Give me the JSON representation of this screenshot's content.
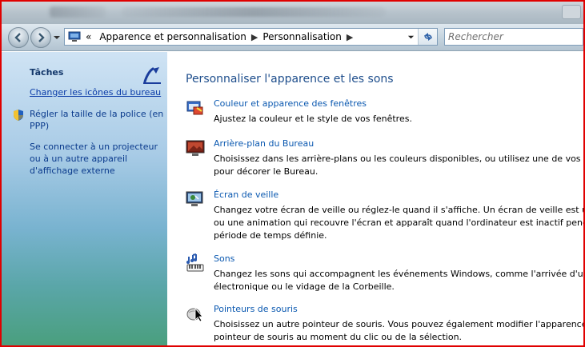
{
  "address": {
    "crumbs": [
      "Apparence et personnalisation",
      "Personnalisation"
    ],
    "overflow_chevron": "«"
  },
  "search": {
    "placeholder": "Rechercher"
  },
  "sidebar": {
    "title": "Tâches",
    "links": [
      {
        "lines": [
          "Changer les icônes du bureau"
        ]
      },
      {
        "lines": [
          "Régler la taille de la police (en",
          "PPP)"
        ]
      },
      {
        "lines": [
          "Se connecter à un projecteur",
          "ou à un autre appareil",
          "d'affichage externe"
        ]
      }
    ]
  },
  "main": {
    "title": "Personnaliser l'apparence et les sons",
    "items": [
      {
        "icon": "window-color-icon",
        "label": "Couleur et apparence des fenêtres",
        "desc": [
          "Ajustez la couleur et le style de vos fenêtres."
        ]
      },
      {
        "icon": "desktop-background-icon",
        "label": "Arrière-plan du Bureau",
        "desc": [
          "Choisissez dans les arrière-plans ou les couleurs disponibles, ou utilisez une de vos images",
          "pour décorer le Bureau."
        ]
      },
      {
        "icon": "screensaver-icon",
        "label": "Écran de veille",
        "desc": [
          "Changez votre écran de veille ou réglez-le quand il s'affiche. Un écran de veille est une image",
          "ou une animation qui recouvre l'écran et apparaît quand l'ordinateur est inactif pendant une",
          "période de temps définie."
        ]
      },
      {
        "icon": "sounds-icon",
        "label": "Sons",
        "desc": [
          "Changez les sons qui accompagnent les événements Windows, comme l'arrivée d'un message",
          "électronique ou le vidage de la Corbeille."
        ]
      },
      {
        "icon": "mouse-pointer-icon",
        "label": "Pointeurs de souris",
        "desc": [
          "Choisissez un autre pointeur de souris. Vous pouvez également modifier l'apparence du",
          "pointeur de souris au moment du clic ou de la sélection."
        ]
      }
    ]
  },
  "colors": {
    "frame": "#e00000",
    "link": "#0a58b0",
    "title": "#1e4e8c"
  }
}
